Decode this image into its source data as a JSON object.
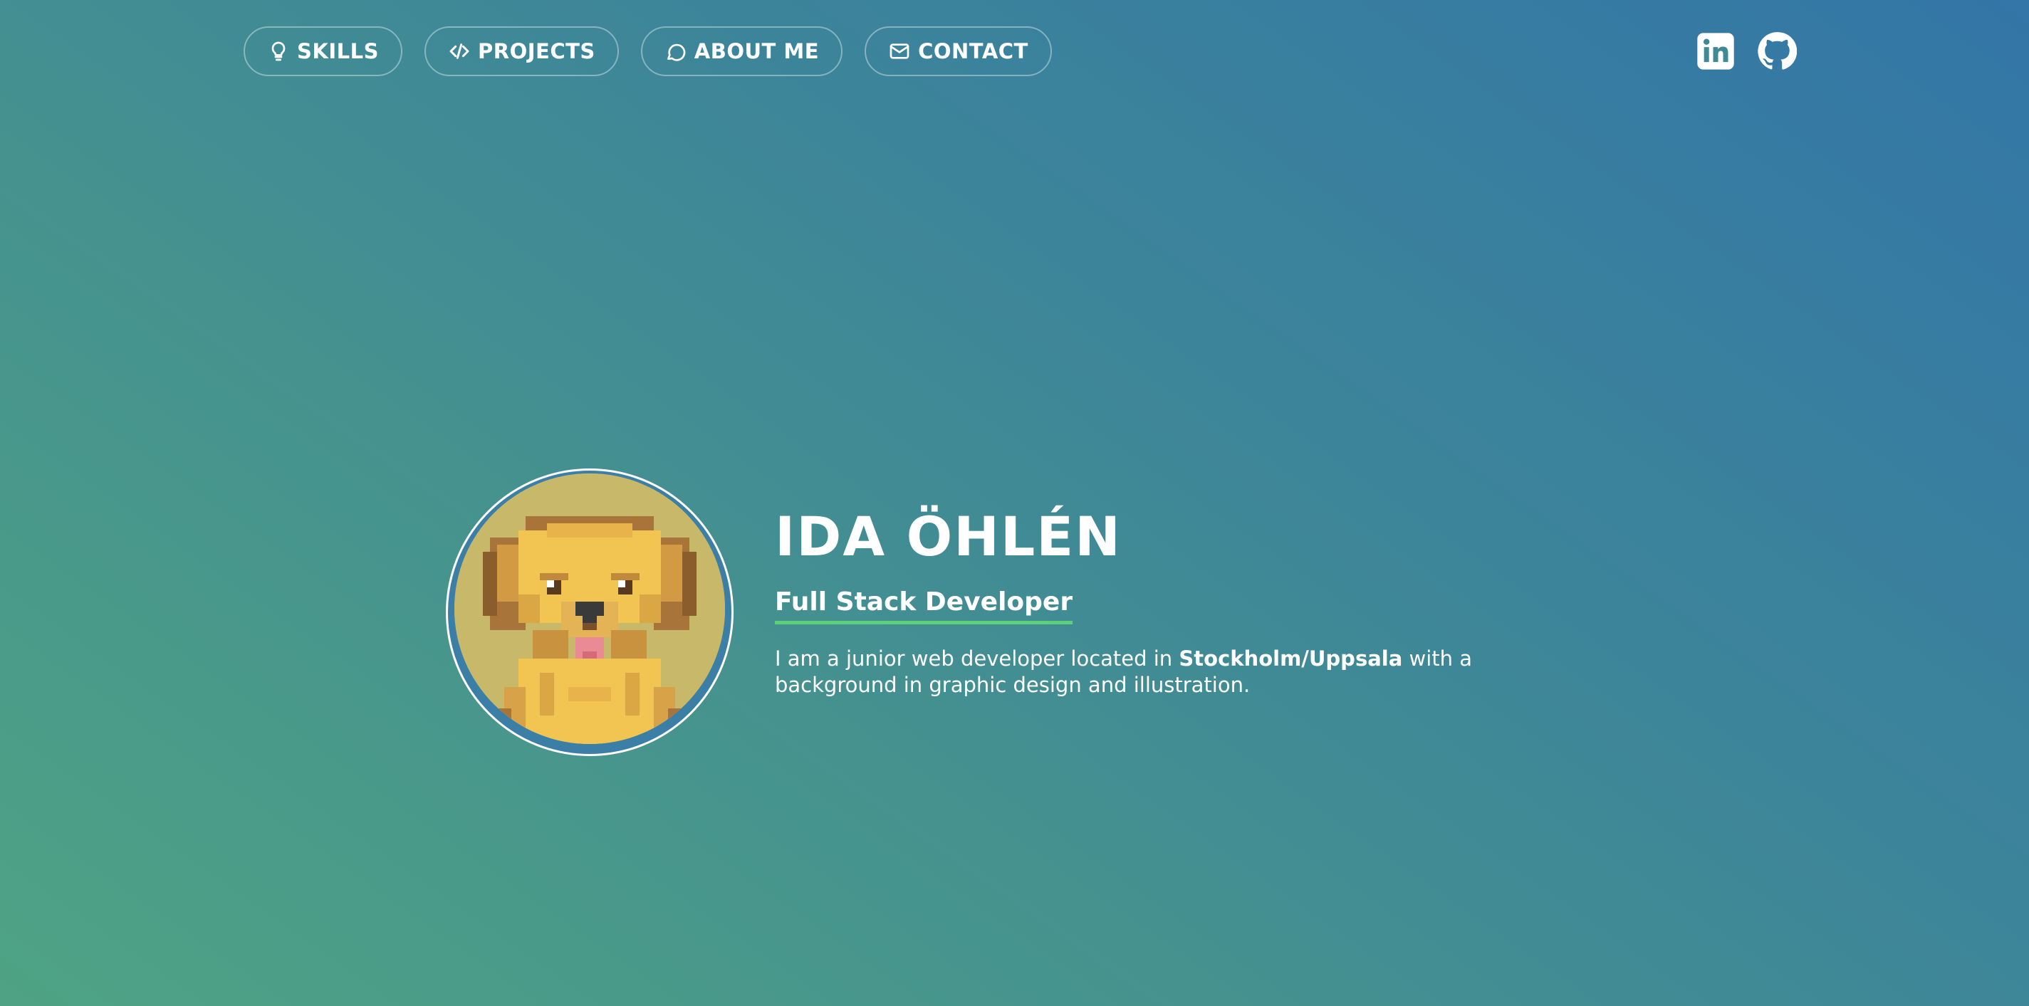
{
  "nav": {
    "items": [
      {
        "label": "SKILLS",
        "icon": "lightbulb-icon"
      },
      {
        "label": "PROJECTS",
        "icon": "code-icon"
      },
      {
        "label": "ABOUT ME",
        "icon": "chat-bubble-icon"
      },
      {
        "label": "CONTACT",
        "icon": "envelope-icon"
      }
    ]
  },
  "social": {
    "items": [
      {
        "icon": "linkedin-icon"
      },
      {
        "icon": "github-icon"
      }
    ]
  },
  "hero": {
    "avatar": {
      "icon": "pixel-dog-avatar"
    },
    "name": "IDA ÖHLÉN",
    "role": "Full Stack Developer",
    "bio_part1": "I am a junior web developer located in ",
    "bio_location": "Stockholm/Uppsala",
    "bio_part2": " with a background in graphic design and illustration."
  },
  "colors": {
    "gradient_start": "#4fa384",
    "gradient_end": "#3376a7",
    "accent_underline": "#5fd07a",
    "text": "#ffffff",
    "avatar_bg": "#c8b86a"
  }
}
